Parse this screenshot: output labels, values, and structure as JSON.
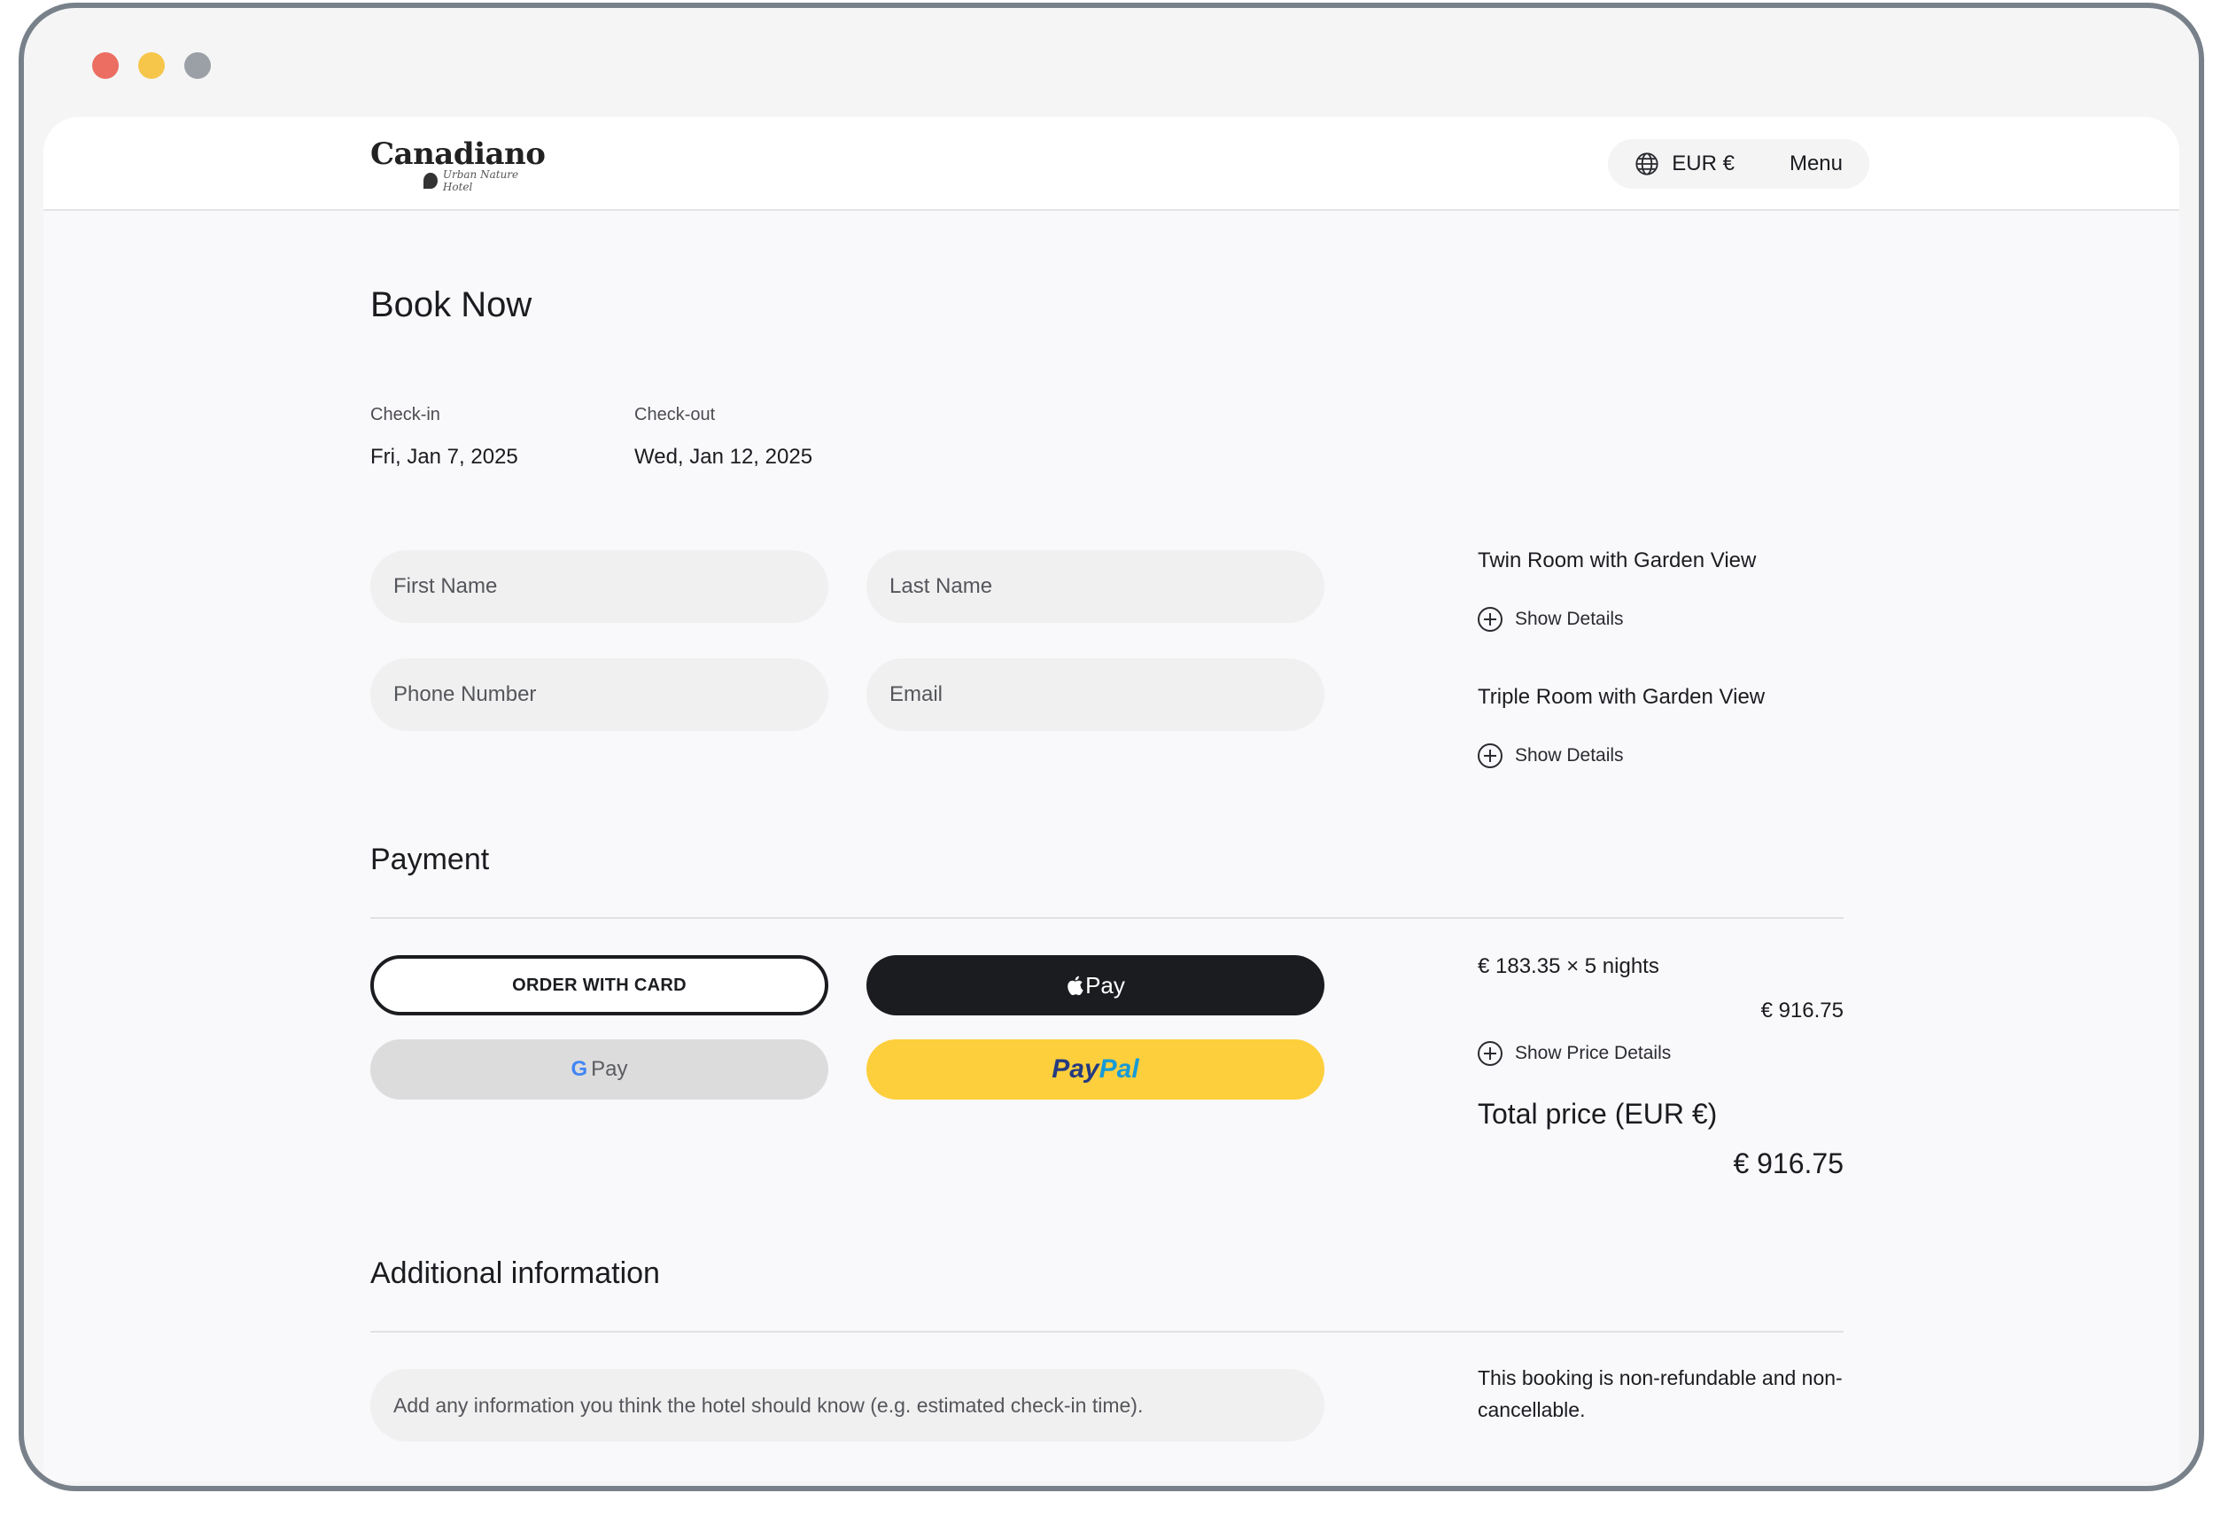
{
  "brand": {
    "name": "Canadiano",
    "tagline": "Urban Nature Hotel"
  },
  "header": {
    "currency": "EUR €",
    "menu": "Menu"
  },
  "title": "Book Now",
  "dates": {
    "checkin_label": "Check-in",
    "checkin_value": "Fri, Jan 7, 2025",
    "checkout_label": "Check-out",
    "checkout_value": "Wed, Jan 12, 2025"
  },
  "form": {
    "first_name": "First Name",
    "last_name": "Last Name",
    "phone": "Phone Number",
    "email": "Email"
  },
  "rooms": [
    {
      "name": "Twin Room with Garden View",
      "details": "Show Details"
    },
    {
      "name": "Triple Room with Garden View",
      "details": "Show Details"
    }
  ],
  "payment": {
    "heading": "Payment",
    "card": "ORDER WITH CARD",
    "apple": "Pay",
    "google_g": "G",
    "google": "Pay",
    "paypal_a": "Pay",
    "paypal_b": "Pal"
  },
  "pricing": {
    "rate": "€ 183.35 × 5 nights",
    "subtotal": "€ 916.75",
    "details": "Show Price Details",
    "total_label": "Total price (EUR €)",
    "total_value": "€ 916.75"
  },
  "additional": {
    "heading": "Additional information",
    "placeholder": "Add any information you think the hotel should know (e.g. estimated check-in time).",
    "note": "This booking is non-refundable and non-cancellable."
  },
  "colors": {
    "dark": "#1b1c20",
    "paypal_yellow": "#fecf3c",
    "gpay_gray": "#dcdcdd"
  }
}
